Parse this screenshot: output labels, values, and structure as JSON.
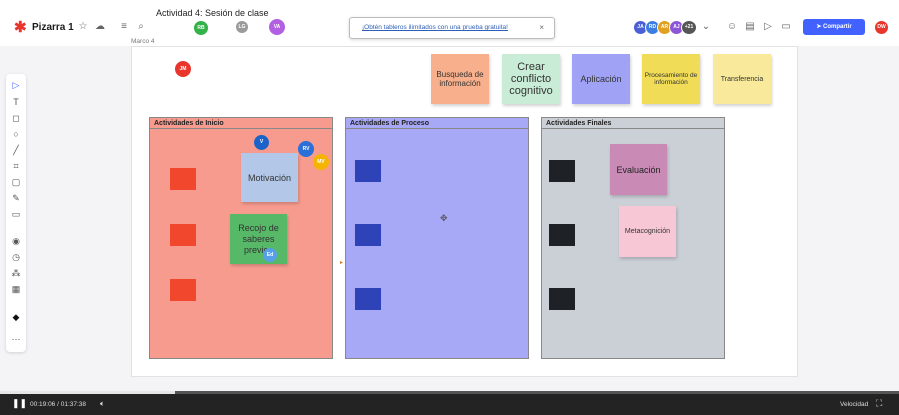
{
  "topbar": {
    "board_title": "Pizarra 1",
    "overlay_title": "Actividad 4: Sesión de clase",
    "promo_text": "¡Obtén tableros ilimitados con una prueba gratuita!",
    "promo_close": "×",
    "share_label": "Compartir",
    "share_icon": "send-icon",
    "avatars": [
      {
        "initials": "JA",
        "color": "#4a5fd6"
      },
      {
        "initials": "RD",
        "color": "#3b7de0"
      },
      {
        "initials": "AR",
        "color": "#e0a020"
      },
      {
        "initials": "AJ",
        "color": "#8d56d6"
      },
      {
        "initials": "+21",
        "color": "#555555"
      }
    ],
    "user_avatar": {
      "initials": "DW",
      "color": "#e8362d"
    },
    "overlay_avatars": [
      {
        "initials": "RB",
        "color": "#33b249"
      },
      {
        "initials": "LG",
        "color": "#9a9a9a"
      },
      {
        "initials": "VA",
        "color": "#b060e0"
      }
    ]
  },
  "toolbar": {
    "tools": [
      "select-icon",
      "text-icon",
      "sticky-note-icon",
      "shape-icon",
      "line-icon",
      "frame-icon",
      "comment-icon",
      "pen-icon",
      "template-icon",
      "eye-icon",
      "timer-icon",
      "apps-icon",
      "grid-icon",
      "diamond-icon",
      "more-icon"
    ]
  },
  "canvas": {
    "frame_label": "Marco 4",
    "top_notes": [
      {
        "text": "Busqueda de información",
        "color": "#f8b08c"
      },
      {
        "text": "Crear conflicto cognitivo",
        "color": "#c9ecd6"
      },
      {
        "text": "Aplicación",
        "color": "#9fa2f5"
      },
      {
        "text": "Procesamiento de información",
        "color": "#f0dc56"
      },
      {
        "text": "Transferencia",
        "color": "#f8ea9a"
      }
    ],
    "columns": [
      {
        "title": "Actividades de Inicio",
        "color": "#f79b8e",
        "square_color": "#f0472d"
      },
      {
        "title": "Actividades de Proceso",
        "color": "#a7a8f6",
        "square_color": "#2f43b8"
      },
      {
        "title": "Actividades Finales",
        "color": "#cbcfd6",
        "square_color": "#1e2226"
      }
    ],
    "inner_notes": [
      {
        "text": "Motivación",
        "color": "#b3c7e8"
      },
      {
        "text": "Recojo de saberes previos",
        "color": "#57b868"
      },
      {
        "text": "Evaluación",
        "color": "#c98bb6"
      },
      {
        "text": "Metacognición",
        "color": "#f7c7d6"
      }
    ],
    "cursors": [
      {
        "initials": "JM",
        "color": "#e8362d"
      },
      {
        "initials": "V",
        "color": "#1c63c9"
      },
      {
        "initials": "RV",
        "color": "#2b6fd8"
      },
      {
        "initials": "MV",
        "color": "#f5b400"
      },
      {
        "initials": "Ed",
        "color": "#56a0e8"
      }
    ]
  },
  "video": {
    "time": "00:19:06 / 01:37:38",
    "speed_label": "Velocidad",
    "progress": 0.195
  }
}
